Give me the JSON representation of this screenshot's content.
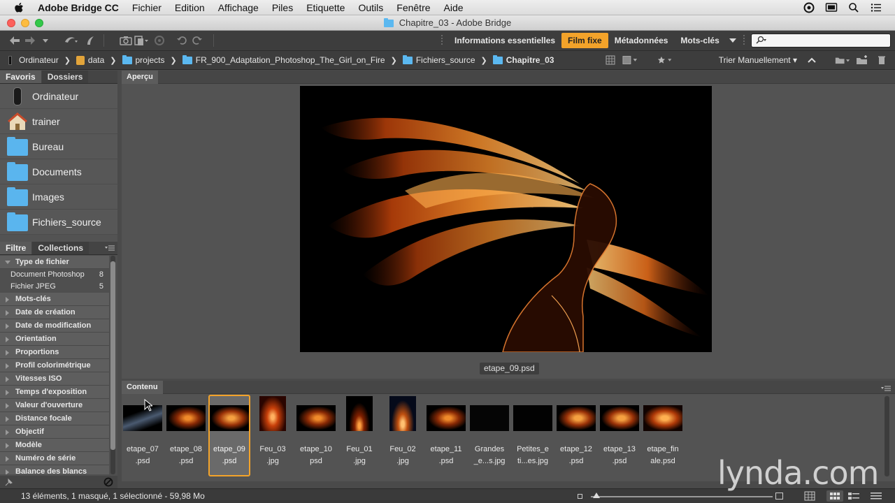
{
  "menubar": {
    "app_name": "Adobe Bridge CC",
    "items": [
      "Fichier",
      "Edition",
      "Affichage",
      "Piles",
      "Etiquette",
      "Outils",
      "Fenêtre",
      "Aide"
    ]
  },
  "window": {
    "title": "Chapitre_03 - Adobe Bridge"
  },
  "workspaces": {
    "items": [
      "Informations essentielles",
      "Film fixe",
      "Métadonnées",
      "Mots-clés"
    ],
    "active": "Film fixe"
  },
  "search": {
    "value": "",
    "placeholder": ""
  },
  "breadcrumb": [
    "Ordinateur",
    "data",
    "projects",
    "FR_900_Adaptation_Photoshop_The_Girl_on_Fire",
    "Fichiers_source",
    "Chapitre_03"
  ],
  "sort": {
    "label": "Trier Manuellement"
  },
  "left_tabs": [
    "Favoris",
    "Dossiers"
  ],
  "favorites": [
    "Ordinateur",
    "trainer",
    "Bureau",
    "Documents",
    "Images",
    "Fichiers_source"
  ],
  "filter_tabs": [
    "Filtre",
    "Collections"
  ],
  "filter": {
    "groups": [
      "Type de fichier",
      "Mots-clés",
      "Date de création",
      "Date de modification",
      "Orientation",
      "Proportions",
      "Profil colorimétrique",
      "Vitesses ISO",
      "Temps d'exposition",
      "Valeur d'ouverture",
      "Distance focale",
      "Objectif",
      "Modèle",
      "Numéro de série",
      "Balance des blancs"
    ],
    "file_types": [
      {
        "name": "Document Photoshop",
        "count": "8"
      },
      {
        "name": "Fichier JPEG",
        "count": "5"
      }
    ]
  },
  "preview": {
    "tab": "Aperçu",
    "caption": "etape_09.psd"
  },
  "content": {
    "tab": "Contenu",
    "thumbnails": [
      {
        "label": "etape_07\n.psd"
      },
      {
        "label": "etape_08\n.psd"
      },
      {
        "label": "etape_09\n.psd",
        "selected": true
      },
      {
        "label": "Feu_03\n.jpg"
      },
      {
        "label": "etape_10\npsd"
      },
      {
        "label": "Feu_01\n.jpg"
      },
      {
        "label": "Feu_02\n.jpg"
      },
      {
        "label": "etape_11\n.psd"
      },
      {
        "label": "Grandes\n_e...s.jpg"
      },
      {
        "label": "Petites_e\nti...es.jpg"
      },
      {
        "label": "etape_12\n.psd"
      },
      {
        "label": "etape_13\n.psd"
      },
      {
        "label": "etape_fin\nale.psd"
      }
    ]
  },
  "status": {
    "text": "13 éléments, 1 masqué, 1 sélectionné - 59,98 Mo"
  },
  "watermark": "lynda.com",
  "colors": {
    "accent": "#f3a32a",
    "folder": "#5ab5ee",
    "panel": "#535353"
  }
}
